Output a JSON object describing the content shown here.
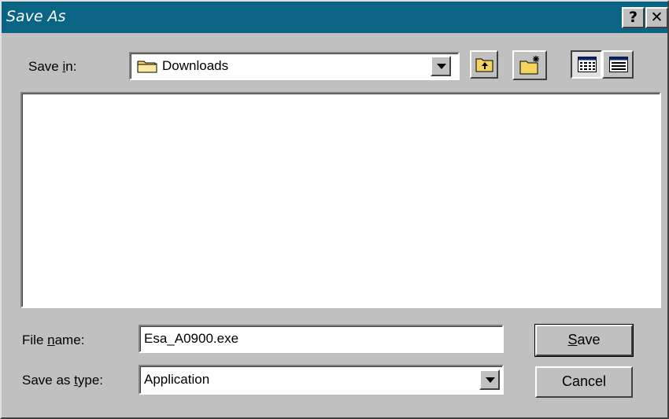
{
  "dialog": {
    "title": "Save As"
  },
  "titlebar": {
    "help_label": "?",
    "close_label": "✕"
  },
  "save_in": {
    "label_pre": "Save ",
    "label_accel": "i",
    "label_post": "n:",
    "value": "Downloads"
  },
  "toolbar": {
    "up_one_level_icon": "up-folder-icon",
    "new_folder_icon": "new-folder-icon",
    "list_view_icon": "list-view-icon",
    "details_view_icon": "details-view-icon"
  },
  "file_name": {
    "label_pre": "File ",
    "label_accel": "n",
    "label_post": "ame:",
    "value": "Esa_A0900.exe"
  },
  "save_as_type": {
    "label_pre": "Save as ",
    "label_accel": "t",
    "label_post": "ype:",
    "value": "Application"
  },
  "buttons": {
    "save_accel": "S",
    "save_rest": "ave",
    "cancel": "Cancel"
  },
  "colors": {
    "titlebar": "#0a6484",
    "face": "#c0c0c0",
    "folder": "#f4d35e"
  }
}
